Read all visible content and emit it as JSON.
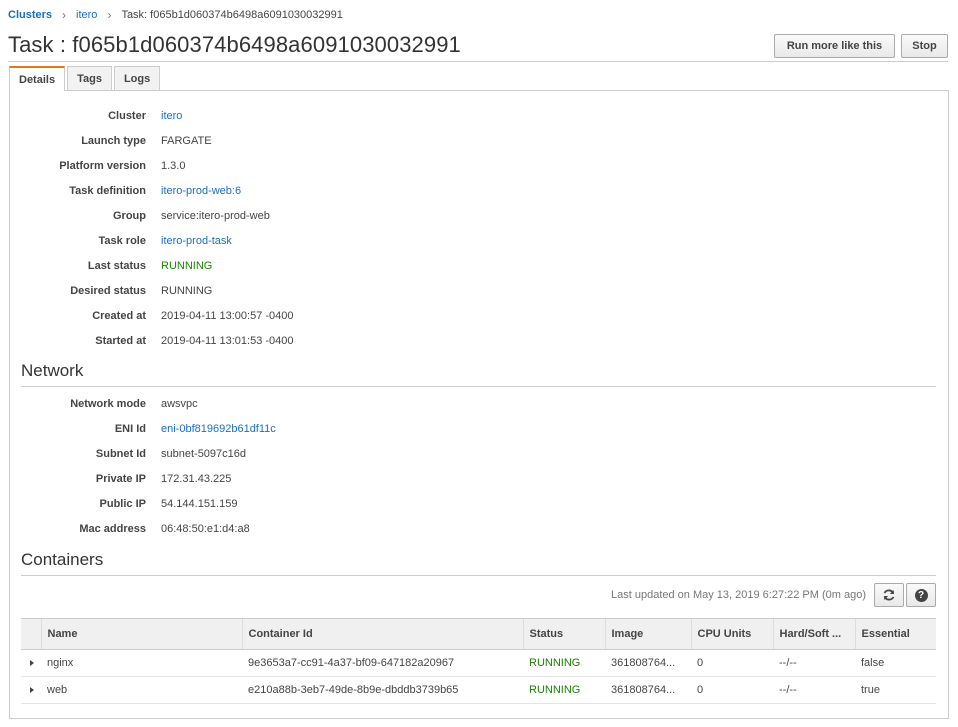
{
  "breadcrumb": {
    "clusters": "Clusters",
    "cluster": "itero",
    "current": "Task: f065b1d060374b6498a6091030032991",
    "separator": "›"
  },
  "page": {
    "title": "Task : f065b1d060374b6498a6091030032991",
    "run_more_label": "Run more like this",
    "stop_label": "Stop"
  },
  "tabs": [
    {
      "label": "Details",
      "active": true
    },
    {
      "label": "Tags",
      "active": false
    },
    {
      "label": "Logs",
      "active": false
    }
  ],
  "details": {
    "cluster": {
      "label": "Cluster",
      "value": "itero"
    },
    "launch_type": {
      "label": "Launch type",
      "value": "FARGATE"
    },
    "platform_version": {
      "label": "Platform version",
      "value": "1.3.0"
    },
    "task_definition": {
      "label": "Task definition",
      "value": "itero-prod-web:6"
    },
    "group": {
      "label": "Group",
      "value": "service:itero-prod-web"
    },
    "task_role": {
      "label": "Task role",
      "value": "itero-prod-task"
    },
    "last_status": {
      "label": "Last status",
      "value": "RUNNING"
    },
    "desired_status": {
      "label": "Desired status",
      "value": "RUNNING"
    },
    "created_at": {
      "label": "Created at",
      "value": "2019-04-11 13:00:57 -0400"
    },
    "started_at": {
      "label": "Started at",
      "value": "2019-04-11 13:01:53 -0400"
    }
  },
  "network": {
    "heading": "Network",
    "network_mode": {
      "label": "Network mode",
      "value": "awsvpc"
    },
    "eni_id": {
      "label": "ENI Id",
      "value": "eni-0bf819692b61df11c"
    },
    "subnet_id": {
      "label": "Subnet Id",
      "value": "subnet-5097c16d"
    },
    "private_ip": {
      "label": "Private IP",
      "value": "172.31.43.225"
    },
    "public_ip": {
      "label": "Public IP",
      "value": "54.144.151.159"
    },
    "mac_address": {
      "label": "Mac address",
      "value": "06:48:50:e1:d4:a8"
    }
  },
  "containers": {
    "heading": "Containers",
    "last_updated": "Last updated on May 13, 2019 6:27:22 PM (0m ago)",
    "columns": {
      "name": "Name",
      "container_id": "Container Id",
      "status": "Status",
      "image": "Image",
      "cpu_units": "CPU Units",
      "hard_soft": "Hard/Soft ...",
      "essential": "Essential"
    },
    "rows": [
      {
        "name": "nginx",
        "container_id": "9e3653a7-cc91-4a37-bf09-647182a20967",
        "status": "RUNNING",
        "image": "361808764...",
        "cpu_units": "0",
        "hard_soft": "--/--",
        "essential": "false"
      },
      {
        "name": "web",
        "container_id": "e210a88b-3eb7-49de-8b9e-dbddb3739b65",
        "status": "RUNNING",
        "image": "361808764...",
        "cpu_units": "0",
        "hard_soft": "--/--",
        "essential": "true"
      }
    ]
  },
  "icons": {
    "refresh": "refresh-icon",
    "help": "help-icon",
    "expand": "chevron-right-icon"
  },
  "colors": {
    "link": "#1a6fbf",
    "running": "#1d8102",
    "active_tab_accent": "#e47911"
  }
}
